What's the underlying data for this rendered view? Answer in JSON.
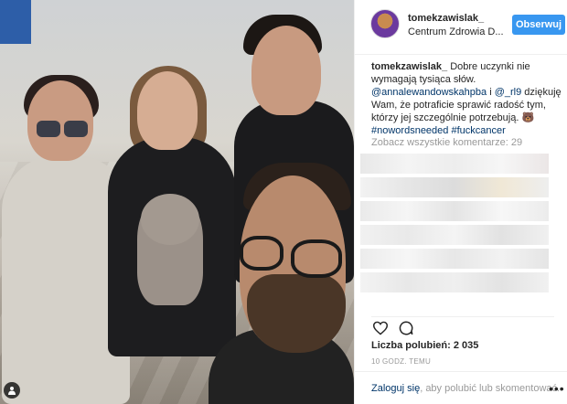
{
  "post": {
    "username": "tomekzawislak_",
    "location": "Centrum Zdrowia D...",
    "follow_label": "Obserwuj",
    "caption": {
      "username": "tomekzawislak_",
      "line1": " Dobre uczynki nie wymagają tysiąca słów.",
      "mention1": "@annalewandowskahpba",
      "and": " i ",
      "mention2": "@_rl9",
      "line2": " dziękuję Wam, że potraficie sprawić radość tym, którzy jej szczególnie potrzebują. ",
      "emoji": "🐻",
      "hashtag1": "#nowordsneeded",
      "hashtag2": "#fuckcancer"
    },
    "more_comments": "Zobacz wszystkie komentarze: 29",
    "likes_label": "Liczba polubień: 2 035",
    "time": "10 GODZ. TEMU",
    "login_link": "Zaloguj się",
    "login_rest": ", aby polubić lub skomentować.",
    "more_dots": "•••"
  },
  "icons": {
    "heart": "heart-icon",
    "comment": "comment-icon",
    "user": "user-icon"
  },
  "colors": {
    "follow_button": "#3897f0",
    "link": "#003569",
    "muted": "#999999"
  }
}
